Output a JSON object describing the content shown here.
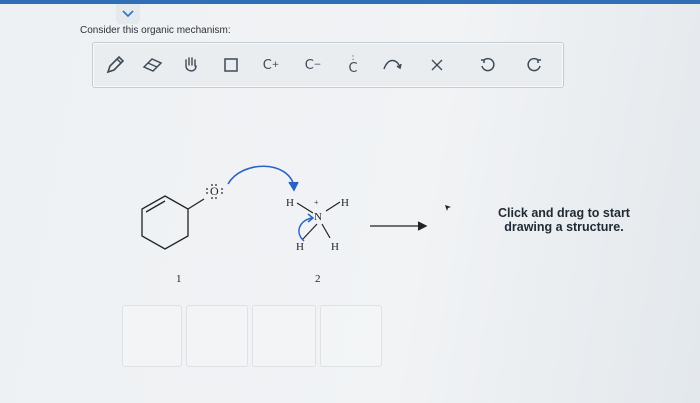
{
  "prompt": "Consider this organic mechanism:",
  "toolbar": {
    "tools": [
      {
        "name": "pencil-icon"
      },
      {
        "name": "eraser-icon"
      },
      {
        "name": "hand-icon"
      },
      {
        "name": "square-icon"
      },
      {
        "name": "carbocation-tool",
        "label": "C",
        "sup": "+"
      },
      {
        "name": "carbanion-tool",
        "label": "C",
        "sup": "−"
      },
      {
        "name": "lone-pair-tool",
        "label": "C",
        "dots": ":"
      },
      {
        "name": "curved-arrow-icon"
      },
      {
        "name": "close-icon"
      },
      {
        "name": "undo-icon"
      },
      {
        "name": "redo-icon"
      }
    ]
  },
  "molecules": {
    "atom_o": "O",
    "compound1_number": "1",
    "atom_n": "N",
    "n_charge": "+",
    "h_top_left": "H",
    "h_top_right": "H",
    "h_bottom_left": "H",
    "h_bottom_right": "H",
    "compound2_number": "2"
  },
  "hint": "Click and drag to start drawing a structure.",
  "colors": {
    "accent": "#2f6fb5",
    "arrow": "#2b63c2",
    "toolbar": "#e9edf0"
  }
}
